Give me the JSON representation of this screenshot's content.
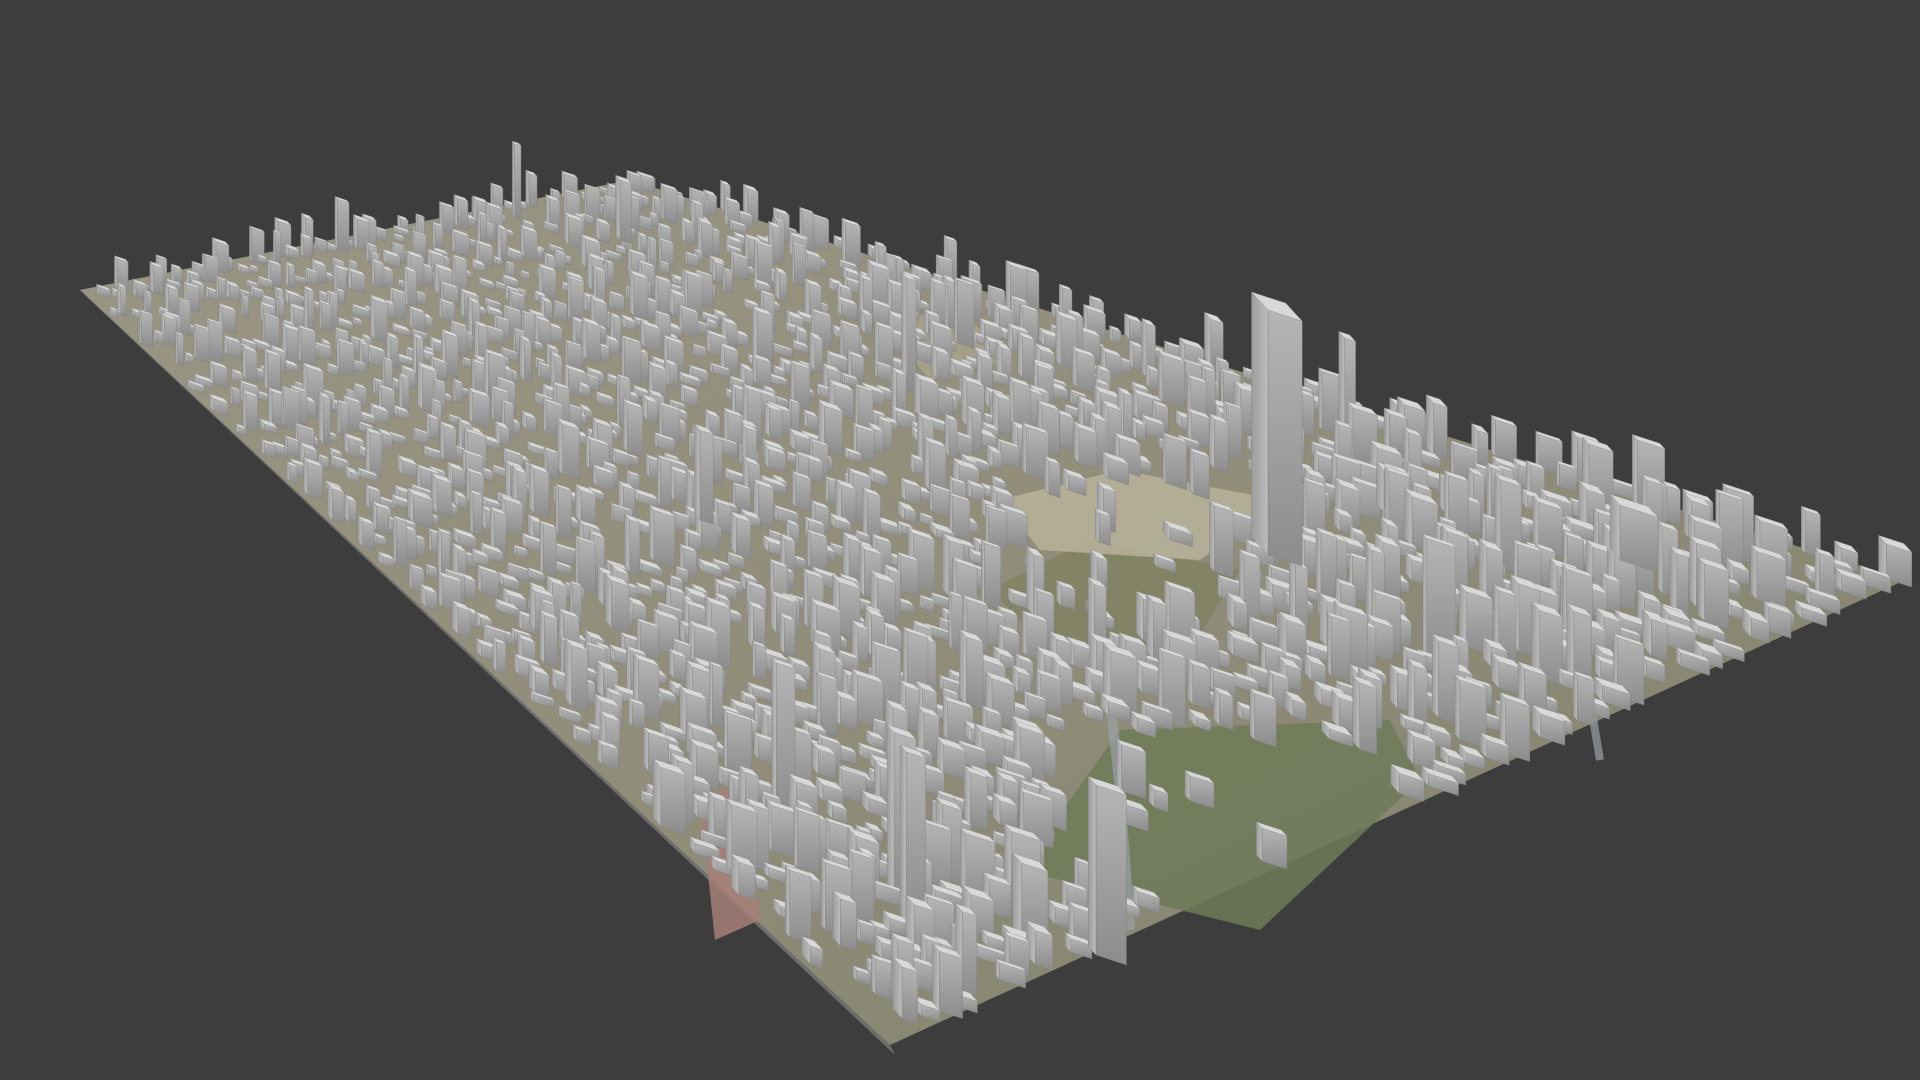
{
  "viewport": {
    "background_color": "#3d3d3d"
  },
  "scene": {
    "subject": "3d-city-block-model",
    "building_color": "#d8d8d8",
    "building_side_color": "#a9a9a9",
    "building_shadow_color": "#8e8e8e",
    "ground_color": "#8f8c78",
    "park_color": "#6f7a58",
    "plaza_color": "#b9b39a",
    "rail_color": "#a77f78"
  }
}
